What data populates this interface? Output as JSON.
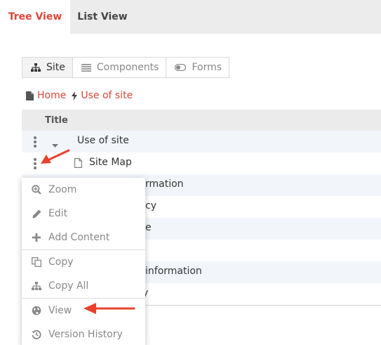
{
  "tabs": [
    {
      "label": "Tree View",
      "active": true
    },
    {
      "label": "List View",
      "active": false
    }
  ],
  "segments": [
    {
      "label": "Site",
      "icon": "sitemap-icon",
      "active": true
    },
    {
      "label": "Components",
      "icon": "list-icon",
      "active": false
    },
    {
      "label": "Forms",
      "icon": "toggle-icon",
      "active": false
    }
  ],
  "breadcrumb": [
    {
      "label": "Home",
      "icon": "file-icon"
    },
    {
      "label": "Use of site",
      "icon": "bolt-icon"
    }
  ],
  "table": {
    "header": "Title",
    "rows": [
      {
        "text": "Use of site"
      },
      {
        "text": "Site Map"
      },
      {
        "text": "rmation"
      },
      {
        "text": "cy"
      },
      {
        "text": "e"
      },
      {
        "text": ""
      },
      {
        "text": "information"
      },
      {
        "text": "y"
      }
    ]
  },
  "menu": {
    "items": [
      {
        "label": "Zoom",
        "icon": "zoom-in-icon"
      },
      {
        "label": "Edit",
        "icon": "pencil-icon"
      },
      {
        "label": "Add Content",
        "icon": "plus-icon"
      },
      {
        "label": "Copy",
        "icon": "copy-icon"
      },
      {
        "label": "Copy All",
        "icon": "sitemap-icon"
      },
      {
        "label": "View",
        "icon": "globe-icon"
      },
      {
        "label": "Version History",
        "icon": "history-icon"
      }
    ]
  },
  "colors": {
    "accent": "#d9473a",
    "arrow": "#e8412c",
    "row_alt": "#f2f6fb",
    "tabbar_bg": "#ececec"
  }
}
